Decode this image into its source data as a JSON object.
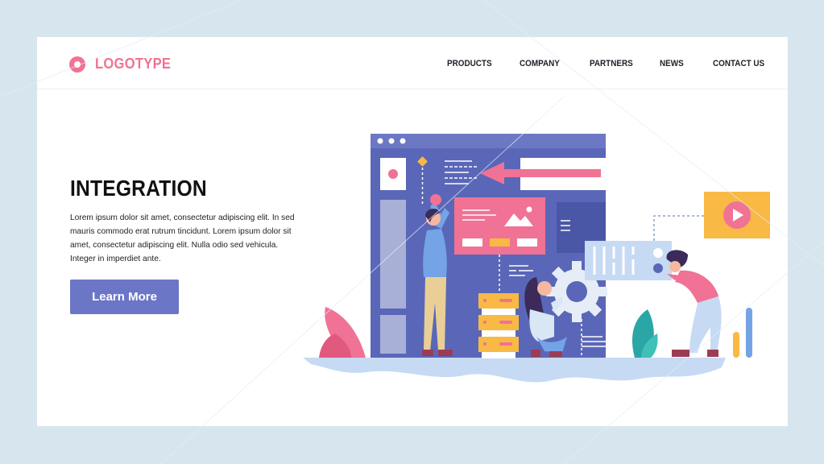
{
  "header": {
    "logo_text": "LOGOTYPE",
    "nav": [
      {
        "label": "PRODUCTS"
      },
      {
        "label": "COMPANY"
      },
      {
        "label": "PARTNERS"
      },
      {
        "label": "NEWS"
      },
      {
        "label": "CONTACT US"
      }
    ]
  },
  "hero": {
    "title": "INTEGRATION",
    "body": "Lorem ipsum dolor sit amet, consectetur adipiscing elit. In sed mauris commodo erat rutrum tincidunt. Lorem ipsum dolor sit amet, consectetur adipiscing elit. Nulla  odio sed vehicula. Integer in imperdiet ante.",
    "cta_label": "Learn More"
  },
  "illustration": {
    "subject": "team integrating web interface components",
    "icons": [
      "browser-window-icon",
      "gear-icon",
      "server-stack-icon",
      "video-play-icon",
      "image-card-icon",
      "equalizer-panel-icon",
      "bar-chart-icon"
    ]
  },
  "colors": {
    "background": "#d7e6ee",
    "card": "#ffffff",
    "brand_pink": "#f07294",
    "button": "#6c76c7",
    "window": "#5a67b8",
    "window_bar": "#6c78c4",
    "yellow": "#f8b945",
    "light_blue": "#c7daf4",
    "teal": "#2aa6a6"
  }
}
